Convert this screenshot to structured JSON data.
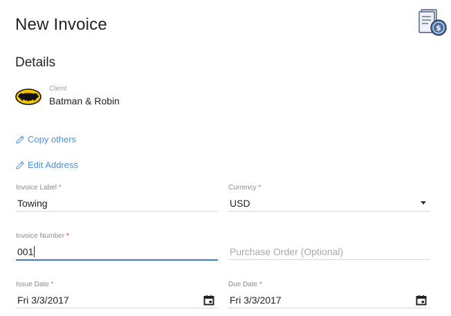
{
  "header": {
    "title": "New Invoice"
  },
  "details": {
    "section_title": "Details"
  },
  "client": {
    "caption": "Client",
    "name": "Batman & Robin"
  },
  "links": {
    "copy_others": "Copy others",
    "edit_address": "Edit Address"
  },
  "fields": {
    "invoice_label": {
      "label": "Invoice Label",
      "required": "*",
      "value": "Towing"
    },
    "currency": {
      "label": "Currency",
      "required": "*",
      "value": "USD"
    },
    "invoice_number": {
      "label": "Invoice Number",
      "required": "*",
      "value": "001"
    },
    "purchase_order": {
      "placeholder": "Purchase Order (Optional)"
    },
    "issue_date": {
      "label": "Issue Date",
      "required": "*",
      "value": "Fri 3/3/2017"
    },
    "due_date": {
      "label": "Due Date",
      "required": "*",
      "value": "Fri 3/3/2017"
    }
  },
  "colors": {
    "link": "#4a90d9",
    "focus": "#3b78c4",
    "required": "#c62828"
  },
  "icons": [
    "invoice-dollar-icon",
    "batman-logo",
    "pencil-icon",
    "calendar-icon",
    "dropdown-arrow-icon"
  ]
}
